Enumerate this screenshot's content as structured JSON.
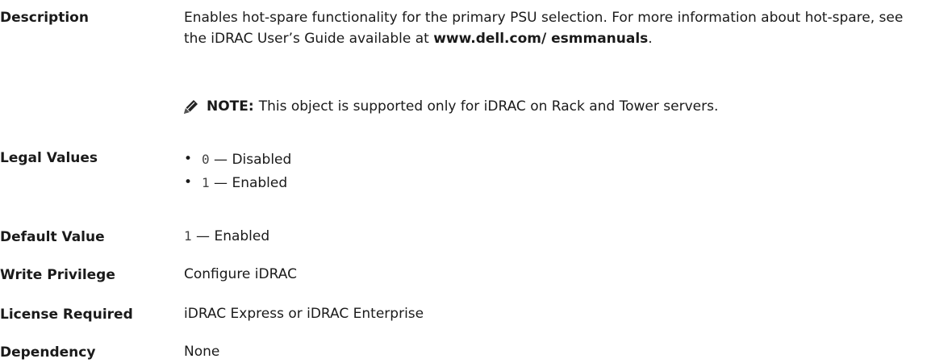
{
  "description": {
    "label": "Description",
    "text_before_link": "Enables hot-spare functionality for the primary PSU selection. For more information about hot-spare, see the iDRAC User’s Guide available at ",
    "link": "www.dell.com/ esmmanuals",
    "text_after_link": ".",
    "note": {
      "icon": "pencil-note-icon",
      "label": "NOTE:",
      "text": "This object is supported only for iDRAC on Rack and Tower servers."
    }
  },
  "legal_values": {
    "label": "Legal Values",
    "items": [
      {
        "bullet": "•",
        "code": "0",
        "separator": "—",
        "text": "Disabled"
      },
      {
        "bullet": "•",
        "code": "1",
        "separator": "—",
        "text": "Enabled"
      }
    ]
  },
  "default_value": {
    "label": "Default Value",
    "code": "1",
    "separator": "—",
    "text": "Enabled"
  },
  "write_privilege": {
    "label": "Write Privilege",
    "text": "Configure iDRAC"
  },
  "license_required": {
    "label": "License Required",
    "text": "iDRAC Express or iDRAC Enterprise"
  },
  "dependency": {
    "label": "Dependency",
    "text": "None"
  }
}
